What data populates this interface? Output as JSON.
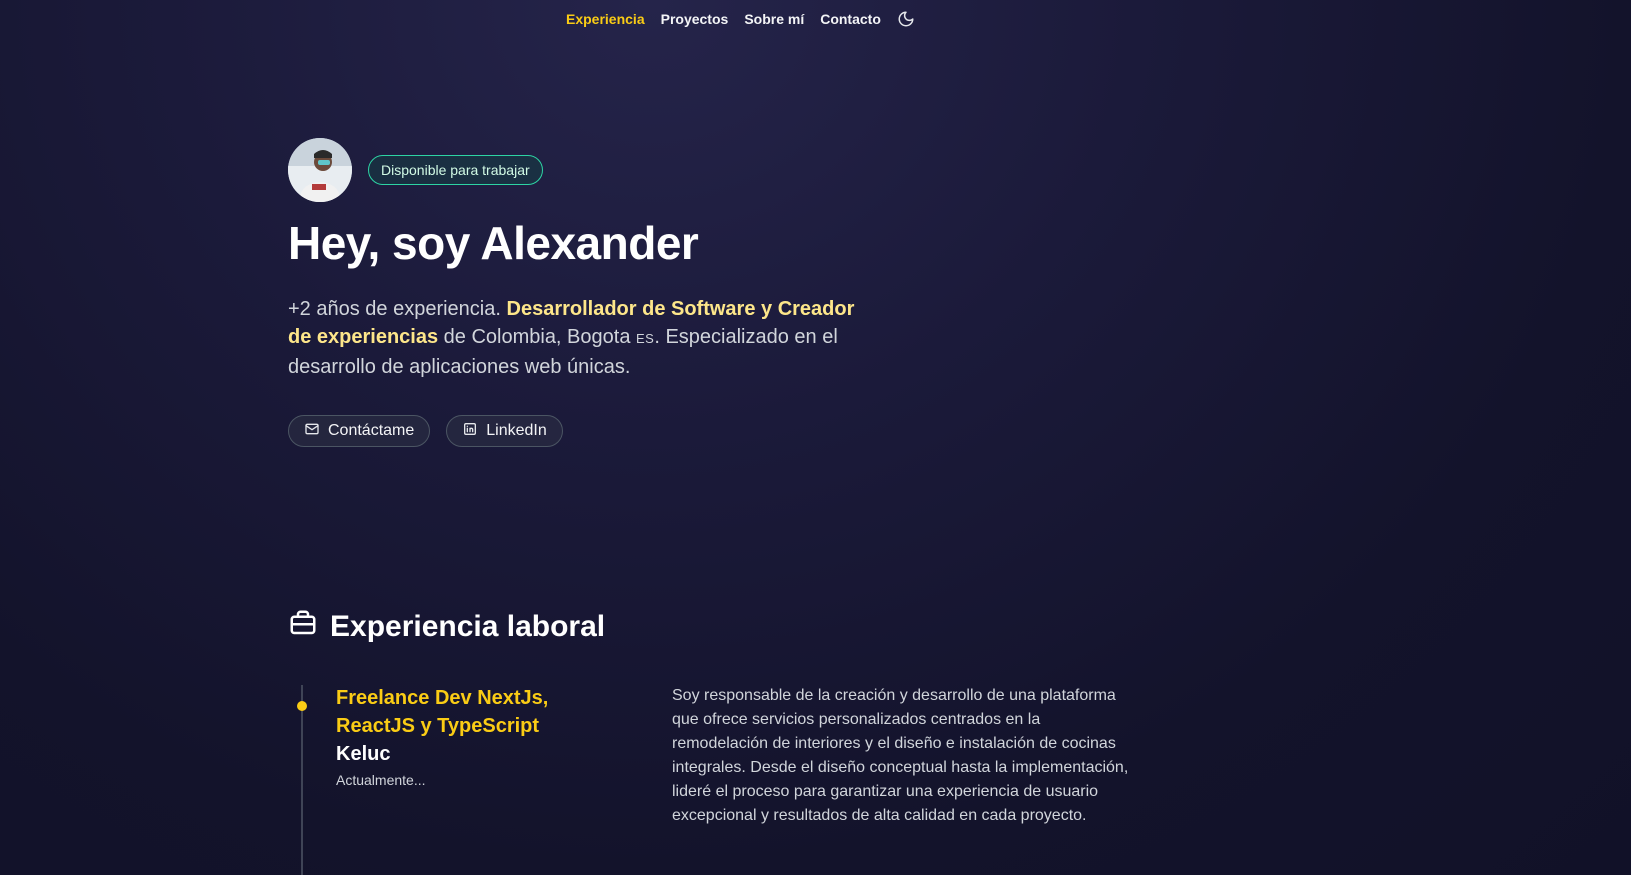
{
  "nav": {
    "items": [
      {
        "label": "Experiencia",
        "active": true
      },
      {
        "label": "Proyectos",
        "active": false
      },
      {
        "label": "Sobre mí",
        "active": false
      },
      {
        "label": "Contacto",
        "active": false
      }
    ],
    "theme_icon": "moon-icon"
  },
  "hero": {
    "badge": "Disponible para trabajar",
    "title": "Hey, soy Alexander",
    "intro_prefix": "+2 años de experiencia. ",
    "intro_highlight": "Desarrollador de Software y Creador de experiencias",
    "intro_middle": " de Colombia, Bogota ",
    "intro_flag": "ES",
    "intro_suffix": ". Especializado en el desarrollo de aplicaciones web únicas.",
    "buttons": [
      {
        "label": "Contáctame",
        "icon": "mail-icon"
      },
      {
        "label": "LinkedIn",
        "icon": "linkedin-icon"
      }
    ]
  },
  "experience": {
    "section_title": "Experiencia laboral",
    "section_icon": "briefcase-icon",
    "jobs": [
      {
        "title": "Freelance Dev NextJs, ReactJS y TypeScript",
        "company": "Keluc",
        "date": "Actualmente...",
        "description": "Soy responsable de la creación y desarrollo de una plataforma que ofrece servicios personalizados centrados en la remodelación de interiores y el diseño e instalación de cocinas integrales. Desde el diseño conceptual hasta la implementación, lideré el proceso para garantizar una experiencia de usuario excepcional y resultados de alta calidad en cada proyecto."
      }
    ]
  },
  "colors": {
    "accent": "#facc15",
    "highlight": "#fde68a",
    "badge_border": "#2dd4a4",
    "background": "#16162f"
  }
}
